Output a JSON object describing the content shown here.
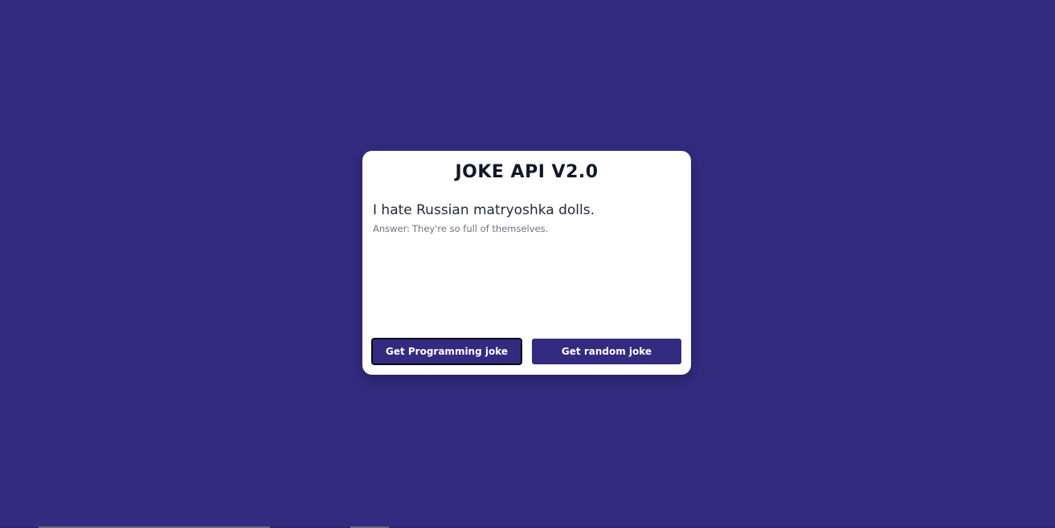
{
  "app": {
    "title": "JOKE API V2.0"
  },
  "joke": {
    "question": "I hate Russian matryoshka dolls.",
    "answer_prefix": "Answer:",
    "answer": "They're so full of themselves."
  },
  "buttons": {
    "programming_label": "Get Programming joke",
    "random_label": "Get random joke"
  },
  "colors": {
    "background": "#322b80",
    "card": "#ffffff",
    "button": "#322b80",
    "button_text": "#ffffff",
    "title_text": "#111827"
  }
}
